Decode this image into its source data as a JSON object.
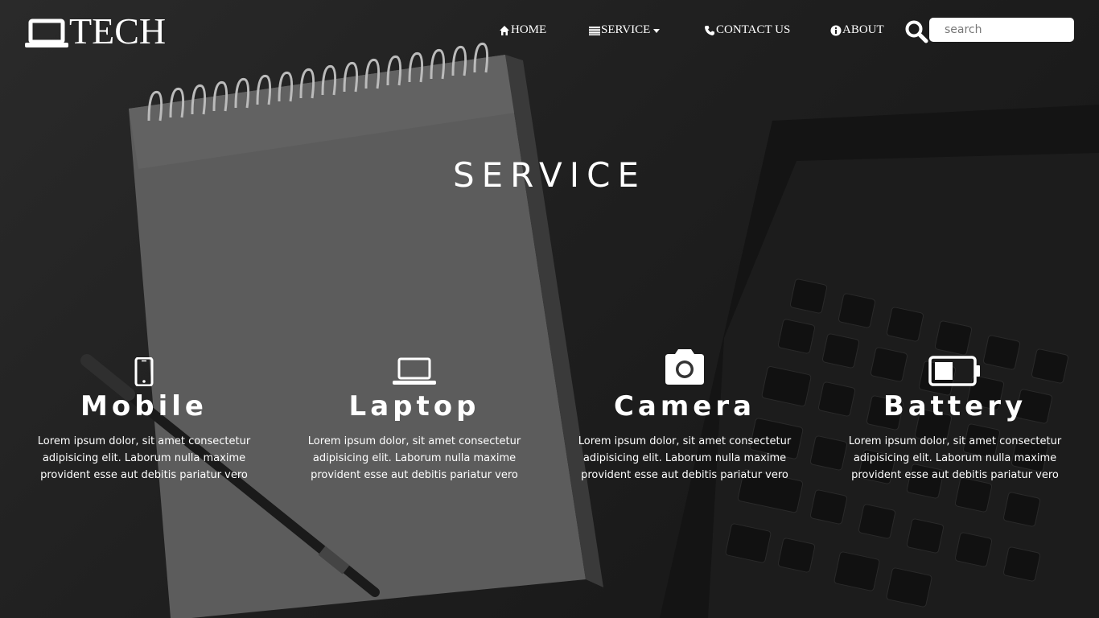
{
  "brand": {
    "name": "TECH",
    "icon": "laptop-icon"
  },
  "nav": {
    "home": {
      "label": "HOME",
      "icon": "home-icon"
    },
    "service": {
      "label": "SERVICE",
      "icon": "list-icon"
    },
    "contact": {
      "label": "CONTACT US",
      "icon": "phone-icon"
    },
    "about": {
      "label": "ABOUT",
      "icon": "info-icon"
    }
  },
  "search": {
    "placeholder": "search",
    "value": "",
    "icon": "search-icon"
  },
  "hero": {
    "title": "SERVICE"
  },
  "services": [
    {
      "title": "Mobile",
      "icon": "mobile-phone-icon",
      "text": "Lorem ipsum dolor, sit amet consectetur adipisicing elit. Laborum nulla maxime provident esse aut debitis pariatur vero"
    },
    {
      "title": "Laptop",
      "icon": "laptop-icon",
      "text": "Lorem ipsum dolor, sit amet consectetur adipisicing elit. Laborum nulla maxime provident esse aut debitis pariatur vero"
    },
    {
      "title": "Camera",
      "icon": "camera-icon",
      "text": "Lorem ipsum dolor, sit amet consectetur adipisicing elit. Laborum nulla maxime provident esse aut debitis pariatur vero"
    },
    {
      "title": "Battery",
      "icon": "battery-icon",
      "text": "Lorem ipsum dolor, sit amet consectetur adipisicing elit. Laborum nulla maxime provident esse aut debitis pariatur vero"
    }
  ],
  "colors": {
    "text": "#ffffff",
    "background": "#1b1b1b",
    "search_bg": "#ffffff"
  }
}
